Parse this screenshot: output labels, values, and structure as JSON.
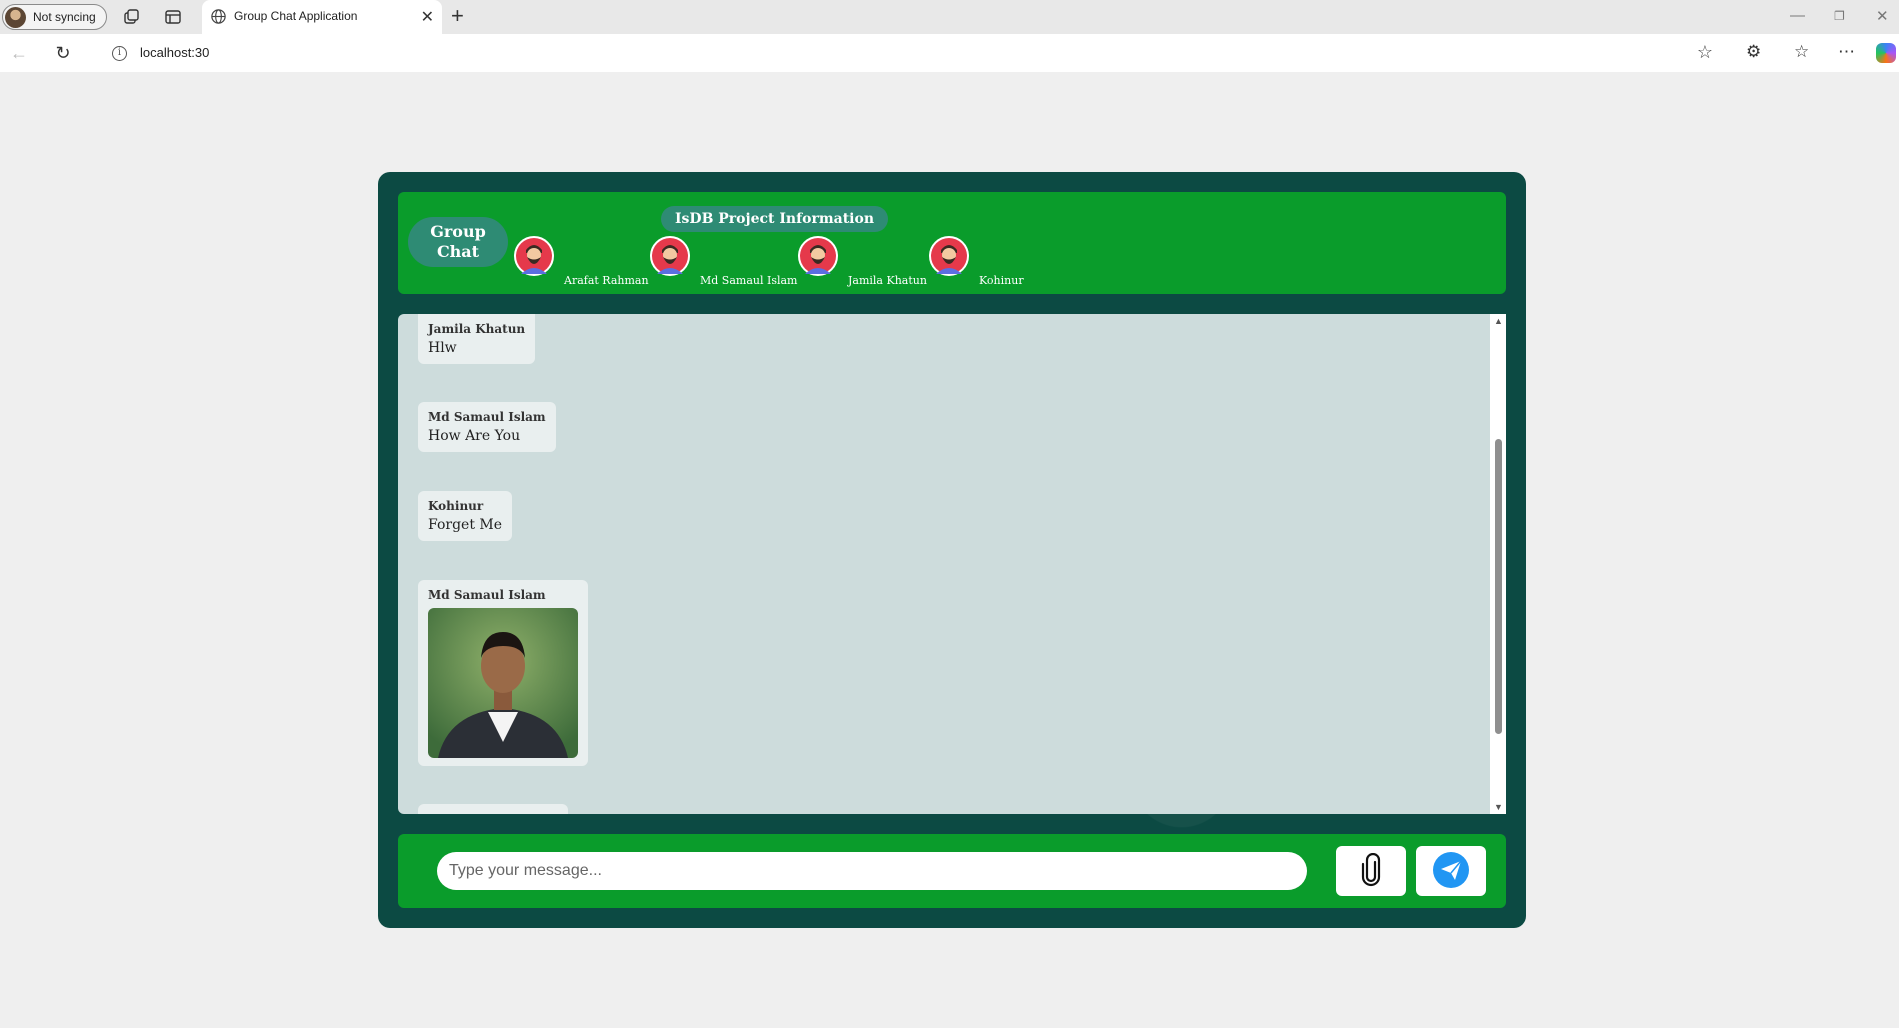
{
  "browser": {
    "profile_label": "Not syncing",
    "tab_title": "Group Chat Application",
    "url": "localhost:30"
  },
  "header": {
    "group_title": "Group Chat",
    "project_title": "IsDB Project Information",
    "members": [
      {
        "name": "Arafat Rahman"
      },
      {
        "name": "Md Samaul Islam"
      },
      {
        "name": "Jamila Khatun"
      },
      {
        "name": "Kohinur"
      }
    ]
  },
  "messages": [
    {
      "sender": "Jamila Khatun",
      "text": "Hlw"
    },
    {
      "sender": "Md Samaul Islam",
      "text": "How Are You"
    },
    {
      "sender": "Kohinur",
      "text": "Forget Me"
    },
    {
      "sender": "Md Samaul Islam",
      "type": "image"
    }
  ],
  "composer": {
    "placeholder": "Type your message...",
    "attach_icon": "paperclip-icon",
    "send_icon": "send-icon"
  },
  "colors": {
    "app_bg": "#0c4a43",
    "header_green": "#0a9c2b",
    "pill": "#2e8b74",
    "chat_bg": "#cddcdc",
    "send_blue": "#2196f3"
  }
}
